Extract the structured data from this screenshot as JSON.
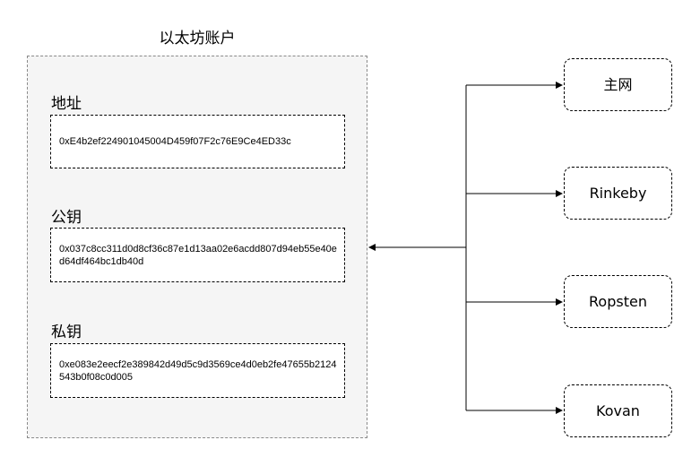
{
  "account": {
    "title": "以太坊账户",
    "fields": [
      {
        "label": "地址",
        "value": "0xE4b2ef224901045004D459f07F2c76E9Ce4ED33c"
      },
      {
        "label": "公钥",
        "value": "0x037c8cc311d0d8cf36c87e1d13aa02e6acdd807d94eb55e40ed64df464bc1db40d"
      },
      {
        "label": "私钥",
        "value": "0xe083e2eecf2e389842d49d5c9d3569ce4d0eb2fe47655b2124543b0f08c0d005"
      }
    ]
  },
  "networks": [
    {
      "label": "主网"
    },
    {
      "label": "Rinkeby"
    },
    {
      "label": "Ropsten"
    },
    {
      "label": "Kovan"
    }
  ],
  "colors": {
    "account_fill": "#f5f5f5",
    "account_border": "#8a8a8a",
    "line": "#000000"
  }
}
